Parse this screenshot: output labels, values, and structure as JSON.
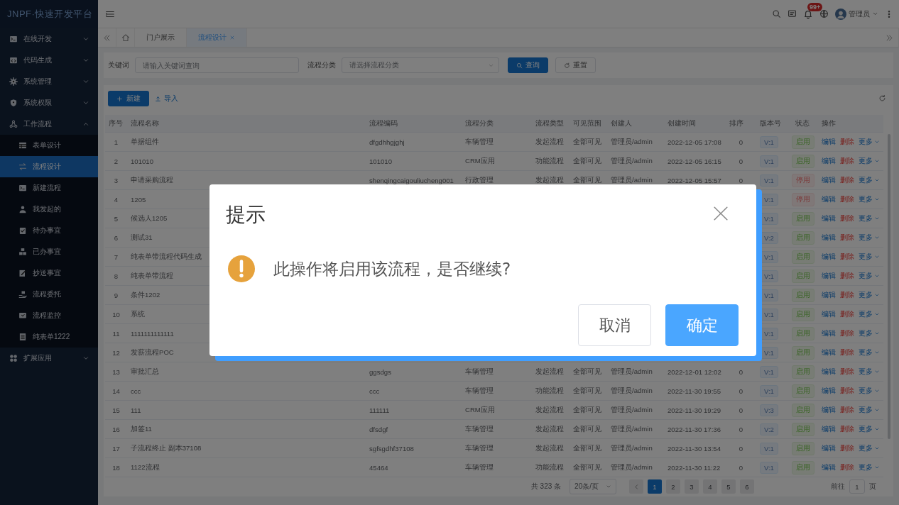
{
  "sidebar": {
    "logo": "JNPF·快速开发平台",
    "items": [
      {
        "label": "在线开发",
        "expanded": false
      },
      {
        "label": "代码生成",
        "expanded": false
      },
      {
        "label": "系统管理",
        "expanded": false
      },
      {
        "label": "系统权限",
        "expanded": false
      },
      {
        "label": "工作流程",
        "expanded": true,
        "children": [
          {
            "label": "表单设计",
            "selected": false
          },
          {
            "label": "流程设计",
            "selected": true
          },
          {
            "label": "新建流程",
            "selected": false
          },
          {
            "label": "我发起的",
            "selected": false
          },
          {
            "label": "待办事宜",
            "selected": false
          },
          {
            "label": "已办事宜",
            "selected": false
          },
          {
            "label": "抄送事宜",
            "selected": false
          },
          {
            "label": "流程委托",
            "selected": false
          },
          {
            "label": "流程监控",
            "selected": false
          },
          {
            "label": "纯表单1222",
            "selected": false
          }
        ]
      },
      {
        "label": "扩展应用",
        "expanded": false
      }
    ]
  },
  "header": {
    "notification_badge": "99+",
    "user": "管理员"
  },
  "tabs": [
    {
      "label": "门户展示",
      "selected": false,
      "closable": false
    },
    {
      "label": "流程设计",
      "selected": true,
      "closable": true
    }
  ],
  "filters": {
    "fields": [
      {
        "label": "关键词",
        "kind": "text",
        "placeholder": "请输入关键词查询"
      },
      {
        "label": "流程分类",
        "kind": "select",
        "placeholder": "请选择流程分类"
      }
    ],
    "buttons": [
      {
        "label": "查询",
        "kind": "primary"
      },
      {
        "label": "重置",
        "kind": "plain"
      }
    ]
  },
  "toolbar": {
    "buttons": [
      {
        "label": "新建",
        "kind": "primary"
      },
      {
        "label": "导入",
        "kind": "link"
      }
    ]
  },
  "table": {
    "columns": [
      "序号",
      "流程名称",
      "流程编码",
      "流程分类",
      "流程类型",
      "可见范围",
      "创建人",
      "创建时间",
      "排序",
      "版本号",
      "状态",
      "操作"
    ],
    "rows": [
      {
        "index": "1",
        "name": "单据组件",
        "code": "dfgdhhgjghj",
        "category": "车辆管理",
        "type": "发起流程",
        "visibility": "全部可见",
        "creator": "管理员/admin",
        "created": "2022-12-05 17:08",
        "sort": "0",
        "version": "V:1",
        "status": "启用",
        "enabled": true,
        "actions": [
          "编辑",
          "删除",
          "更多"
        ]
      },
      {
        "index": "2",
        "name": "101010",
        "code": "101010",
        "category": "CRM应用",
        "type": "功能流程",
        "visibility": "全部可见",
        "creator": "管理员/admin",
        "created": "2022-12-05 16:15",
        "sort": "0",
        "version": "V:1",
        "status": "启用",
        "enabled": true,
        "actions": [
          "编辑",
          "删除",
          "更多"
        ]
      },
      {
        "index": "3",
        "name": "申请采购流程",
        "code": "shenqingcaigouliucheng001",
        "category": "行政管理",
        "type": "发起流程",
        "visibility": "全部可见",
        "creator": "管理员/admin",
        "created": "2022-12-05 15:57",
        "sort": "0",
        "version": "V:1",
        "status": "停用",
        "enabled": false,
        "actions": [
          "编辑",
          "删除",
          "更多"
        ]
      },
      {
        "index": "4",
        "name": "1205",
        "version": "V:1",
        "status": "停用",
        "enabled": false,
        "actions": [
          "编辑",
          "删除",
          "更多"
        ]
      },
      {
        "index": "5",
        "name": "候选人1205",
        "version": "V:1",
        "status": "启用",
        "enabled": true,
        "actions": [
          "编辑",
          "删除",
          "更多"
        ]
      },
      {
        "index": "6",
        "name": "测试31",
        "version": "V:2",
        "status": "启用",
        "enabled": true,
        "actions": [
          "编辑",
          "删除",
          "更多"
        ]
      },
      {
        "index": "7",
        "name": "纯表单带流程代码生成",
        "version": "V:1",
        "status": "启用",
        "enabled": true,
        "actions": [
          "编辑",
          "删除",
          "更多"
        ]
      },
      {
        "index": "8",
        "name": "纯表单带流程",
        "version": "V:1",
        "status": "启用",
        "enabled": true,
        "actions": [
          "编辑",
          "删除",
          "更多"
        ]
      },
      {
        "index": "9",
        "name": "条件1202",
        "version": "V:1",
        "status": "启用",
        "enabled": true,
        "actions": [
          "编辑",
          "删除",
          "更多"
        ]
      },
      {
        "index": "10",
        "name": "系统",
        "version": "V:1",
        "status": "启用",
        "enabled": true,
        "actions": [
          "编辑",
          "删除",
          "更多"
        ]
      },
      {
        "index": "11",
        "name": "1111111111111",
        "version": "V:1",
        "status": "启用",
        "enabled": true,
        "actions": [
          "编辑",
          "删除",
          "更多"
        ]
      },
      {
        "index": "12",
        "name": "发薪流程POC",
        "version": "V:1",
        "status": "启用",
        "enabled": true,
        "actions": [
          "编辑",
          "删除",
          "更多"
        ]
      },
      {
        "index": "13",
        "name": "审批汇总",
        "code": "ggsdgs",
        "category": "车辆管理",
        "type": "发起流程",
        "visibility": "全部可见",
        "creator": "管理员/admin",
        "created": "2022-12-01 12:02",
        "sort": "0",
        "version": "V:1",
        "status": "启用",
        "enabled": true,
        "actions": [
          "编辑",
          "删除",
          "更多"
        ]
      },
      {
        "index": "14",
        "name": "ccc",
        "code": "ccc",
        "category": "车辆管理",
        "type": "功能流程",
        "visibility": "全部可见",
        "creator": "管理员/admin",
        "created": "2022-11-30 19:55",
        "sort": "0",
        "version": "V:1",
        "status": "启用",
        "enabled": true,
        "actions": [
          "编辑",
          "删除",
          "更多"
        ]
      },
      {
        "index": "15",
        "name": "111",
        "code": "111111",
        "category": "CRM应用",
        "type": "发起流程",
        "visibility": "全部可见",
        "creator": "管理员/admin",
        "created": "2022-11-30 19:29",
        "sort": "0",
        "version": "V:3",
        "status": "启用",
        "enabled": true,
        "actions": [
          "编辑",
          "删除",
          "更多"
        ]
      },
      {
        "index": "16",
        "name": "加签11",
        "code": "dfsdgf",
        "category": "车辆管理",
        "type": "发起流程",
        "visibility": "全部可见",
        "creator": "管理员/admin",
        "created": "2022-11-30 17:36",
        "sort": "0",
        "version": "V:2",
        "status": "启用",
        "enabled": true,
        "actions": [
          "编辑",
          "删除",
          "更多"
        ]
      },
      {
        "index": "17",
        "name": "子流程终止 副本37108",
        "code": "sgfsgdhf37108",
        "category": "车辆管理",
        "type": "发起流程",
        "visibility": "全部可见",
        "creator": "管理员/admin",
        "created": "2022-11-30 13:54",
        "sort": "0",
        "version": "V:1",
        "status": "启用",
        "enabled": true,
        "actions": [
          "编辑",
          "删除",
          "更多"
        ]
      },
      {
        "index": "18",
        "name": "1122流程",
        "code": "45464",
        "category": "车辆管理",
        "type": "功能流程",
        "visibility": "全部可见",
        "creator": "管理员/admin",
        "created": "2022-11-30 11:22",
        "sort": "0",
        "version": "V:1",
        "status": "启用",
        "enabled": true,
        "actions": [
          "编辑",
          "删除",
          "更多"
        ]
      }
    ]
  },
  "pagination": {
    "total": "共 323 条",
    "page_size": "20条/页",
    "pages": [
      {
        "label": "1",
        "selected": true
      },
      {
        "label": "2",
        "selected": false
      },
      {
        "label": "3",
        "selected": false
      },
      {
        "label": "4",
        "selected": false
      },
      {
        "label": "5",
        "selected": false
      },
      {
        "label": "6",
        "selected": false
      }
    ],
    "goto_label": "前往",
    "goto_value": "1",
    "goto_suffix": "页"
  },
  "dialog": {
    "title": "提示",
    "message": "此操作将启用该流程，是否继续?",
    "buttons": [
      {
        "label": "取消",
        "kind": "plain"
      },
      {
        "label": "确定",
        "kind": "primary"
      }
    ]
  }
}
